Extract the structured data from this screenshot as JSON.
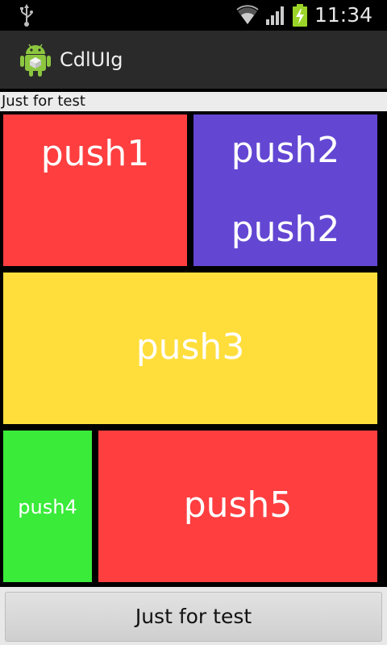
{
  "status_bar": {
    "time": "11:34",
    "icons": [
      "usb-icon",
      "wifi-icon",
      "signal-icon",
      "battery-charging-icon"
    ]
  },
  "action_bar": {
    "app_title": "CdlUIg",
    "app_icon": "android-icon"
  },
  "label_strip": {
    "text": "Just for test"
  },
  "grid": {
    "push1": "push1",
    "push2_line1": "push2",
    "push2_line2": "push2",
    "push3": "push3",
    "push4": "push4",
    "push5": "push5"
  },
  "bottom": {
    "button_label": "Just for test"
  },
  "colors": {
    "red": "#ff3e40",
    "purple": "#6347d3",
    "yellow": "#ffde3c",
    "green": "#3aeb3a"
  }
}
